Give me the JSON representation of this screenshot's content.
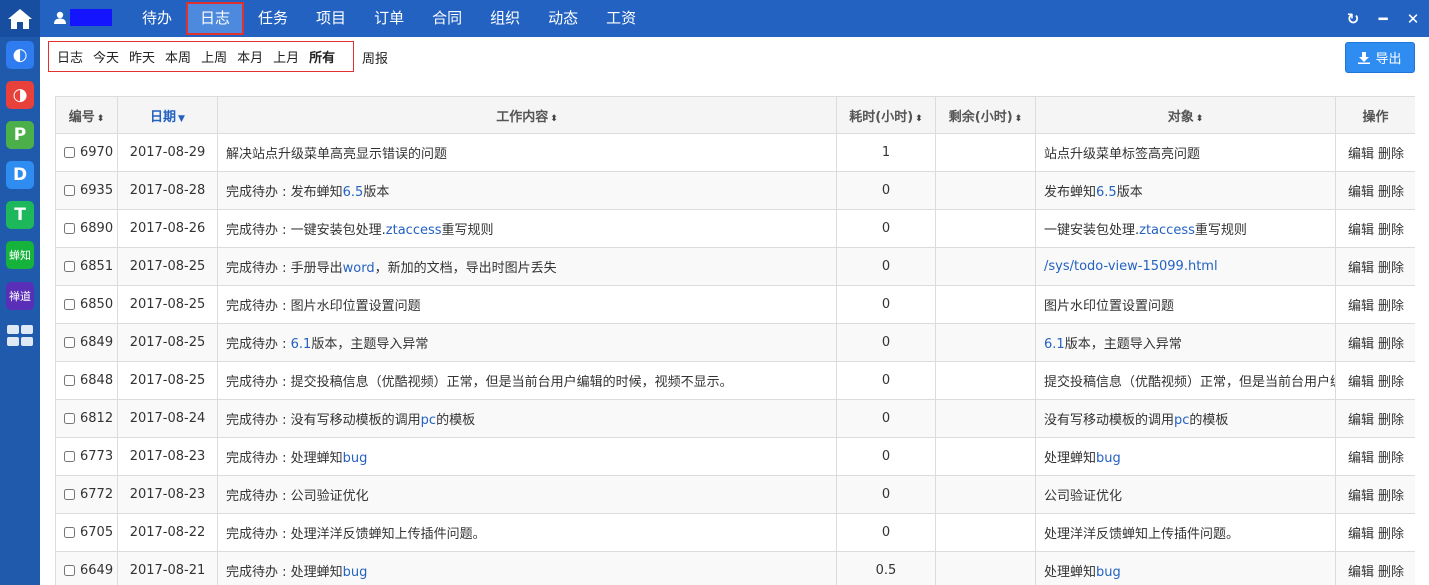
{
  "topnav": {
    "items": [
      "待办",
      "日志",
      "任务",
      "项目",
      "订单",
      "合同",
      "组织",
      "动态",
      "工资"
    ],
    "active": "日志"
  },
  "rail": {
    "apps": [
      {
        "label": "◐",
        "color": "#2f7cf0"
      },
      {
        "label": "◑",
        "color": "#e8403a"
      },
      {
        "label": "P",
        "color": "#4cb04a"
      },
      {
        "label": "D",
        "color": "#2f8cf0"
      },
      {
        "label": "T",
        "color": "#1eb85c"
      },
      {
        "label": "蝉知",
        "color": "#15b33b"
      },
      {
        "label": "禅道",
        "color": "#5a2fb8"
      }
    ]
  },
  "filters": {
    "items": [
      "日志",
      "今天",
      "昨天",
      "本周",
      "上周",
      "本月",
      "上月",
      "所有"
    ],
    "active": "所有",
    "weekly": "周报"
  },
  "export_label": "导出",
  "table": {
    "headers": {
      "id": "编号",
      "date": "日期",
      "content": "工作内容",
      "spent": "耗时(小时)",
      "left": "剩余(小时)",
      "object": "对象",
      "ops": "操作"
    },
    "edit_label": "编辑",
    "delete_label": "删除",
    "rows": [
      {
        "id": "6970",
        "date": "2017-08-29",
        "content": "解决站点升级菜单高亮显示错误的问题",
        "spent": "1",
        "object": "站点升级菜单标签高亮问题"
      },
      {
        "id": "6935",
        "date": "2017-08-28",
        "content": "完成待办 : 发布蝉知6.5版本",
        "spent": "0",
        "object": "发布蝉知6.5版本"
      },
      {
        "id": "6890",
        "date": "2017-08-26",
        "content": "完成待办 : 一键安装包处理.ztaccess重写规则",
        "spent": "0",
        "object": "一键安装包处理.ztaccess重写规则"
      },
      {
        "id": "6851",
        "date": "2017-08-25",
        "content": "完成待办 : 手册导出word，新加的文档，导出时图片丢失",
        "spent": "0",
        "object": "/sys/todo-view-15099.html"
      },
      {
        "id": "6850",
        "date": "2017-08-25",
        "content": "完成待办 : 图片水印位置设置问题",
        "spent": "0",
        "object": "图片水印位置设置问题"
      },
      {
        "id": "6849",
        "date": "2017-08-25",
        "content": "完成待办 : 6.1版本，主题导入异常",
        "spent": "0",
        "object": "6.1版本，主题导入异常"
      },
      {
        "id": "6848",
        "date": "2017-08-25",
        "content": "完成待办 : 提交投稿信息（优酷视频）正常，但是当前台用户编辑的时候，视频不显示。",
        "spent": "0",
        "object": "提交投稿信息（优酷视频）正常，但是当前台用户编辑的时候，视频不显示。"
      },
      {
        "id": "6812",
        "date": "2017-08-24",
        "content": "完成待办 : 没有写移动模板的调用pc的模板",
        "spent": "0",
        "object": "没有写移动模板的调用pc的模板"
      },
      {
        "id": "6773",
        "date": "2017-08-23",
        "content": "完成待办 : 处理蝉知bug",
        "spent": "0",
        "object": "处理蝉知bug"
      },
      {
        "id": "6772",
        "date": "2017-08-23",
        "content": "完成待办 : 公司验证优化",
        "spent": "0",
        "object": "公司验证优化"
      },
      {
        "id": "6705",
        "date": "2017-08-22",
        "content": "完成待办 : 处理洋洋反馈蝉知上传插件问题。",
        "spent": "0",
        "object": "处理洋洋反馈蝉知上传插件问题。"
      },
      {
        "id": "6649",
        "date": "2017-08-21",
        "content": "完成待办 : 处理蝉知bug",
        "spent": "0.5",
        "object": "处理蝉知bug"
      }
    ]
  }
}
